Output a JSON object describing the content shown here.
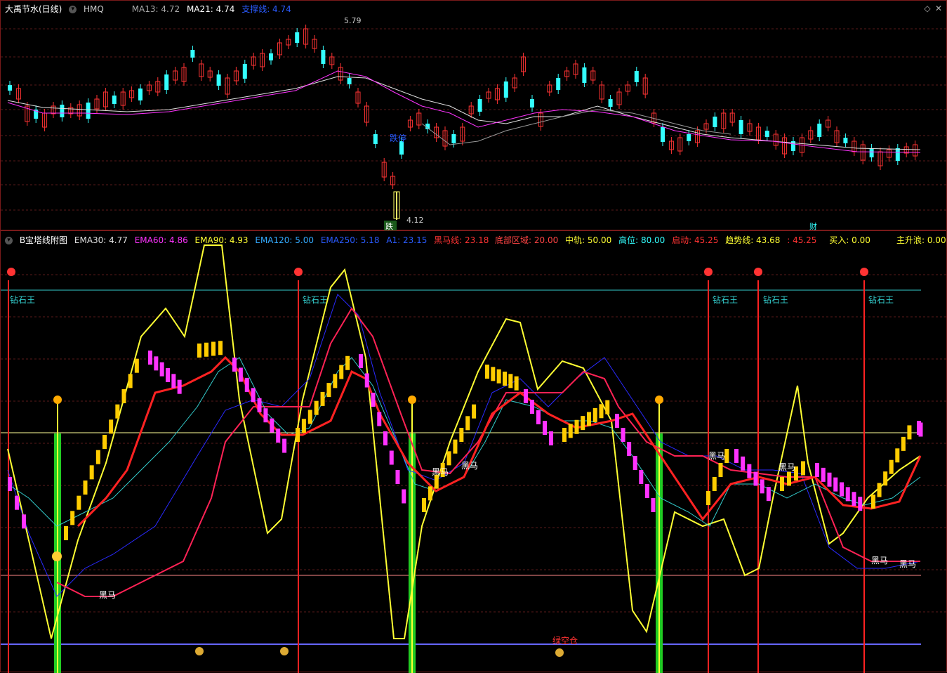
{
  "top": {
    "title": "大禹节水(日线)",
    "sub_label": "HMQ",
    "ma13": "MA13: 4.72",
    "ma21": "MA21: 4.74",
    "support": "支撑线: 4.74",
    "high_label": "5.79",
    "low_label": "4.12",
    "fall_stop_label": "跌停",
    "fall_label": "跌",
    "wealth_label": "财",
    "colors": {
      "ma13": "#e0e0e0",
      "ma21": "#e0e0e0",
      "support": "#2a5bff",
      "up": "#ff3333",
      "down": "#33ffff"
    }
  },
  "bottom": {
    "title": "B宝塔线附图",
    "ema30": "EMA30: 4.77",
    "ema60": "EMA60: 4.86",
    "ema90": "EMA90: 4.93",
    "ema120": "EMA120: 5.00",
    "ema250": "EMA250: 5.18",
    "a1": "A1: 23.15",
    "blackhorse_line": "黑马线: 23.18",
    "bottom_zone": "底部区域: 20.00",
    "mid_track": "中轨: 50.00",
    "high_pos": "高位: 80.00",
    "start": "启动: 45.25",
    "trend_line": "趋势线: 43.68",
    "trend_val": ": 45.25",
    "buy": "买入: 0.00",
    "main_wave": "主升浪: 0.00",
    "diamond_king": "钻石王",
    "black_horse": "黑马",
    "green_empty": "绿空仓",
    "colors": {
      "ema30": "#e0e0e0",
      "ema60": "#ff33ff",
      "ema90": "#ffff33",
      "ema120": "#33aaff",
      "ema250": "#2a5bff",
      "a1": "#2a5bff",
      "blackhorse": "#ff3333",
      "bottom_zone": "#ff4444",
      "mid_track": "#ffff33",
      "high_pos": "#33ffff",
      "start": "#ff3333",
      "trend": "#ffff33",
      "buy": "#ffff33",
      "main_wave": "#ffff33"
    }
  }
}
